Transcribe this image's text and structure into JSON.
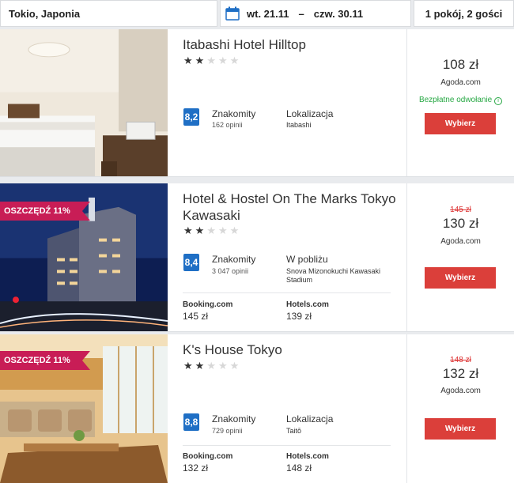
{
  "search": {
    "destination": "Tokio, Japonia",
    "date_from": "wt. 21.11",
    "dash": "–",
    "date_to": "czw. 30.11",
    "guests": "1 pokój, 2 gości"
  },
  "icons": {
    "calendar": "calendar-icon",
    "info": "info-icon",
    "star": "star-icon"
  },
  "colors": {
    "accent": "#1f6fc5",
    "button": "#db3f3a",
    "ribbon": "#c81d56",
    "free_cancel": "#27a844",
    "old_price": "#dd3333"
  },
  "hotels": [
    {
      "name": "Itabashi Hotel Hilltop",
      "stars": 2,
      "stars_max": 5,
      "score": "8,2",
      "rating_word": "Znakomity",
      "reviews": "162 opinii",
      "location_label": "Lokalizacja",
      "location_value": "Itabashi",
      "price": "108 zł",
      "provider": "Agoda.com",
      "free_cancel": "Bezpłatne odwołanie",
      "button": "Wybierz"
    },
    {
      "name": "Hotel & Hostel On The Marks Tokyo Kawasaki",
      "ribbon": "OSZCZĘDŹ 11%",
      "stars": 2,
      "stars_max": 5,
      "score": "8,4",
      "rating_word": "Znakomity",
      "reviews": "3 047 opinii",
      "location_label": "W pobliżu",
      "location_value": "Snova Mizonokuchi Kawasaki Stadium",
      "alt_offers": [
        {
          "provider": "Booking.com",
          "price": "145 zł"
        },
        {
          "provider": "Hotels.com",
          "price": "139 zł"
        }
      ],
      "old_price": "145 zł",
      "price": "130 zł",
      "provider": "Agoda.com",
      "button": "Wybierz"
    },
    {
      "name": "K's House Tokyo",
      "ribbon": "OSZCZĘDŹ 11%",
      "stars": 2,
      "stars_max": 5,
      "score": "8,8",
      "rating_word": "Znakomity",
      "reviews": "729 opinii",
      "location_label": "Lokalizacja",
      "location_value": "Taitō",
      "alt_offers": [
        {
          "provider": "Booking.com",
          "price": "132 zł"
        },
        {
          "provider": "Hotels.com",
          "price": "148 zł"
        }
      ],
      "old_price": "148 zł",
      "price": "132 zł",
      "provider": "Agoda.com",
      "button": "Wybierz"
    }
  ]
}
